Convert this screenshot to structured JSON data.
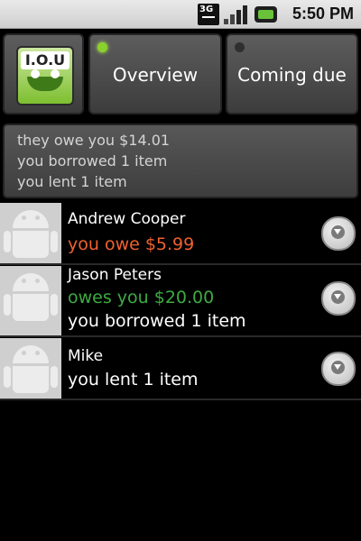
{
  "status_bar": {
    "network": "3G",
    "time": "5:50 PM"
  },
  "app": {
    "logo_text": "I.O.U"
  },
  "tabs": [
    {
      "label": "Overview",
      "active": true
    },
    {
      "label": "Coming due",
      "active": false
    }
  ],
  "summary": {
    "lines": [
      "they owe you $14.01",
      "you borrowed 1 item",
      "you lent 1 item"
    ]
  },
  "contacts": [
    {
      "name": "Andrew Cooper",
      "line2": "you owe $5.99",
      "line2_color": "#f0612f",
      "line3": ""
    },
    {
      "name": "Jason Peters",
      "line2": "owes you $20.00",
      "line2_color": "#3dab41",
      "line3": "you borrowed 1 item"
    },
    {
      "name": "Mike",
      "line2": "you lent 1 item",
      "line2_color": "#ffffff",
      "line3": ""
    }
  ],
  "icons": {
    "contact_photo": "android-avatar-icon",
    "row_menu": "chevron-down-circle-icon",
    "active_indicator": "green-dot-icon"
  }
}
